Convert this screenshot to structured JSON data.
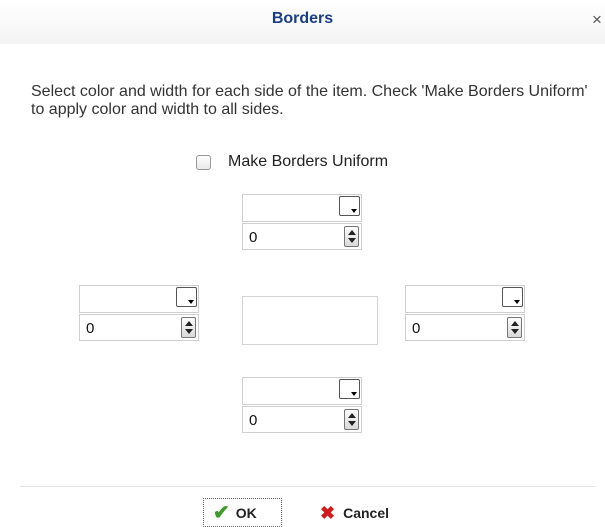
{
  "dialog": {
    "title": "Borders",
    "close_symbol": "×",
    "instructions": "Select color and width for each side of the item. Check 'Make Borders Uniform' to apply color and width to all sides."
  },
  "uniform": {
    "label": "Make Borders Uniform",
    "checked": false
  },
  "borders": {
    "top": {
      "color": "",
      "width": "0"
    },
    "left": {
      "color": "",
      "width": "0"
    },
    "right": {
      "color": "",
      "width": "0"
    },
    "bottom": {
      "color": "",
      "width": "0"
    }
  },
  "buttons": {
    "ok": {
      "label": "OK",
      "icon": "checkmark-icon",
      "icon_color": "#3f9c2a"
    },
    "cancel": {
      "label": "Cancel",
      "icon": "x-icon",
      "icon_color": "#d11b1b"
    }
  },
  "colors": {
    "title": "#1b3d86"
  }
}
